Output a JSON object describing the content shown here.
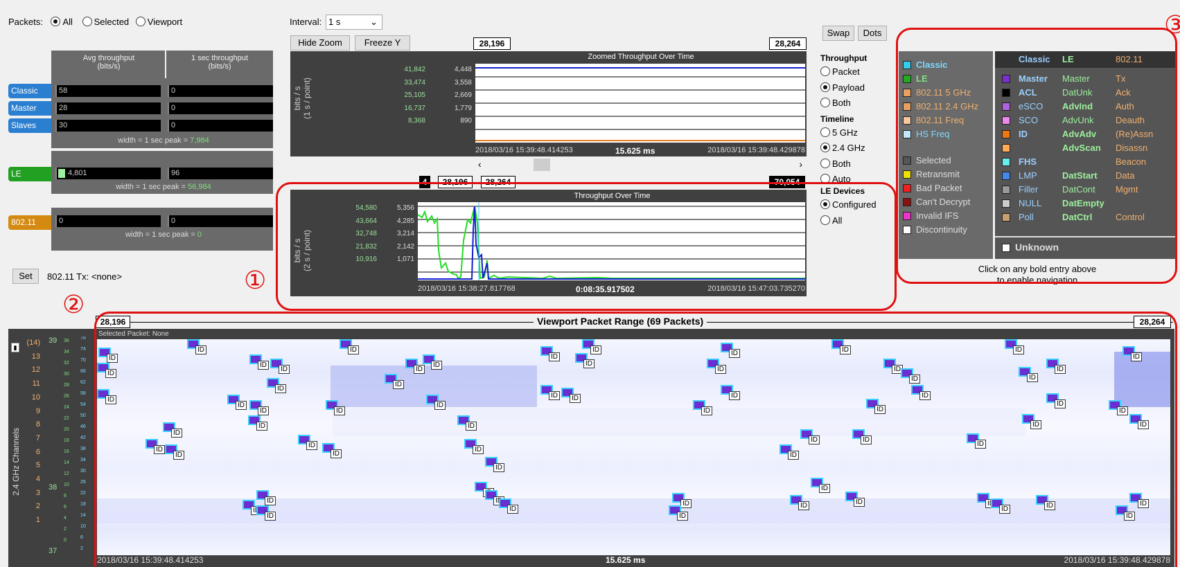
{
  "packets": {
    "label": "Packets:",
    "options": [
      "All",
      "Selected",
      "Viewport"
    ],
    "selected": "All"
  },
  "interval": {
    "label": "Interval:",
    "value": "1 s"
  },
  "buttons": {
    "hide_zoom": "Hide Zoom",
    "freeze_y": "Freeze Y",
    "swap": "Swap",
    "dots": "Dots",
    "set": "Set"
  },
  "throughput_table": {
    "col1": "Avg throughput\n(bits/s)",
    "col2": "1 sec throughput\n(bits/s)",
    "rows": [
      {
        "label": "Classic",
        "avg": "58",
        "sec": "0"
      },
      {
        "label": "Master",
        "avg": "28",
        "sec": "0"
      },
      {
        "label": "Slaves",
        "avg": "30",
        "sec": "0"
      }
    ],
    "classic_peak_prefix": "width = 1 sec peak = ",
    "classic_peak": "7,984",
    "le": {
      "label": "LE",
      "avg": "4,801",
      "sec": "96",
      "peak_prefix": "width = 1 sec peak = ",
      "peak": "56,984"
    },
    "wifi": {
      "label": "802.11",
      "avg": "0",
      "sec": "0",
      "peak_prefix": "width = 1 sec peak = ",
      "peak": "0"
    }
  },
  "tx_text": "802.11 Tx: <none>",
  "zoom_plot": {
    "left_marker": "28,196",
    "right_marker": "28,264",
    "title": "Zoomed Throughput Over Time",
    "ylabel": "bits / s\n(1 s / point)",
    "ticks_a": [
      "41,842",
      "33,474",
      "25,105",
      "16,737",
      "8,368"
    ],
    "ticks_b": [
      "4,448",
      "3,558",
      "2,669",
      "1,779",
      "890"
    ],
    "t_start": "2018/03/16 15:39:48.414253",
    "t_mid": "15.625 ms",
    "t_end": "2018/03/16 15:39:48.429878"
  },
  "nav_markers": {
    "a": "4",
    "b": "28,196",
    "c": "28,264",
    "d": "70,054"
  },
  "main_plot": {
    "title": "Throughput Over Time",
    "ylabel": "bits / s\n(2 s / point)",
    "ticks_a": [
      "54,580",
      "43,664",
      "32,748",
      "21,832",
      "10,916"
    ],
    "ticks_b": [
      "5,356",
      "4,285",
      "3,214",
      "2,142",
      "1,071"
    ],
    "t_start": "2018/03/16 15:38:27.817768",
    "t_mid": "0:08:35.917502",
    "t_end": "2018/03/16 15:47:03.735270"
  },
  "throughput_opts": {
    "heading": "Throughput",
    "options": [
      "Packet",
      "Payload",
      "Both"
    ],
    "selected": "Payload"
  },
  "timeline_opts": {
    "heading": "Timeline",
    "options": [
      "5 GHz",
      "2.4 GHz",
      "Both",
      "Auto"
    ],
    "selected": "2.4 GHz"
  },
  "le_devices": {
    "heading": "LE Devices",
    "options": [
      "Configured",
      "All"
    ],
    "selected": "Configured"
  },
  "legend_left": [
    {
      "label": "Classic",
      "color": "#33ccee",
      "bold": true,
      "tc": "#7fd8ff"
    },
    {
      "label": "LE",
      "color": "#22aa22",
      "bold": true,
      "tc": "#7fe07f"
    },
    {
      "label": "802.11 5 GHz",
      "color": "#e8a060",
      "bold": false,
      "tc": "#f0b070"
    },
    {
      "label": "802.11 2.4 GHz",
      "color": "#e8a060",
      "bold": false,
      "tc": "#f0b070"
    },
    {
      "label": "802.11 Freq",
      "color": "#f5c8a0",
      "bold": false,
      "tc": "#f0b070"
    },
    {
      "label": "HS Freq",
      "color": "#bfe8ff",
      "bold": false,
      "tc": "#7fd8ff"
    },
    {
      "label": "",
      "color": "",
      "bold": false,
      "tc": ""
    },
    {
      "label": "Selected",
      "color": "#555555",
      "bold": false,
      "tc": "#ddd"
    },
    {
      "label": "Retransmit",
      "color": "#f0e000",
      "bold": false,
      "tc": "#ddd"
    },
    {
      "label": "Bad Packet",
      "color": "#ee2020",
      "bold": false,
      "tc": "#ddd"
    },
    {
      "label": "Can't Decrypt",
      "color": "#8b1010",
      "bold": false,
      "tc": "#ddd"
    },
    {
      "label": "Invalid IFS",
      "color": "#ee33cc",
      "bold": false,
      "tc": "#ddd"
    },
    {
      "label": "Discontinuity",
      "color": "#ffffff",
      "bold": false,
      "tc": "#ddd"
    }
  ],
  "legend_right": {
    "headers": [
      "Classic",
      "LE",
      "802.11"
    ],
    "rows": [
      {
        "sw": "#7a30c8",
        "a": "Master",
        "ab": true,
        "b": "Master",
        "bb": false,
        "c": "Tx"
      },
      {
        "sw": "#000000",
        "a": "ACL",
        "ab": true,
        "b": "DatUnk",
        "bb": false,
        "c": "Ack"
      },
      {
        "sw": "#b060e0",
        "a": "eSCO",
        "ab": false,
        "b": "AdvInd",
        "bb": true,
        "c": "Auth"
      },
      {
        "sw": "#ee88ee",
        "a": "SCO",
        "ab": false,
        "b": "AdvUnk",
        "bb": false,
        "c": "Deauth"
      },
      {
        "sw": "#ee7711",
        "a": "ID",
        "ab": true,
        "b": "AdvAdv",
        "bb": true,
        "c": "(Re)Assn"
      },
      {
        "sw": "#ffaa55",
        "a": "",
        "ab": false,
        "b": "AdvScan",
        "bb": true,
        "c": "Disassn"
      },
      {
        "sw": "#66eeee",
        "a": "FHS",
        "ab": true,
        "b": "",
        "bb": false,
        "c": "Beacon"
      },
      {
        "sw": "#4488ee",
        "a": "LMP",
        "ab": false,
        "b": "DatStart",
        "bb": true,
        "c": "Data"
      },
      {
        "sw": "#999999",
        "a": "Filler",
        "ab": false,
        "b": "DatCont",
        "bb": false,
        "c": "Mgmt"
      },
      {
        "sw": "#cccccc",
        "a": "NULL",
        "ab": false,
        "b": "DatEmpty",
        "bb": true,
        "c": ""
      },
      {
        "sw": "#c8a070",
        "a": "Poll",
        "ab": false,
        "b": "DatCtrl",
        "bb": true,
        "c": "Control"
      }
    ],
    "unknown": "Unknown"
  },
  "nav_hint": "Click on any bold entry above\nto enable navigation",
  "annotations": {
    "one": "①",
    "two": "②",
    "three": "③"
  },
  "viewport": {
    "left_marker": "28,196",
    "right_marker": "28,264",
    "title": "Viewport Packet Range (69 Packets)",
    "selected": "Selected Packet: None",
    "ylabel": "2.4 GHz Channels",
    "t_start": "2018/03/16 15:39:48.414253",
    "t_mid": "15.625 ms",
    "t_end": "2018/03/16 15:39:48.429878",
    "tag_label": "ID"
  }
}
